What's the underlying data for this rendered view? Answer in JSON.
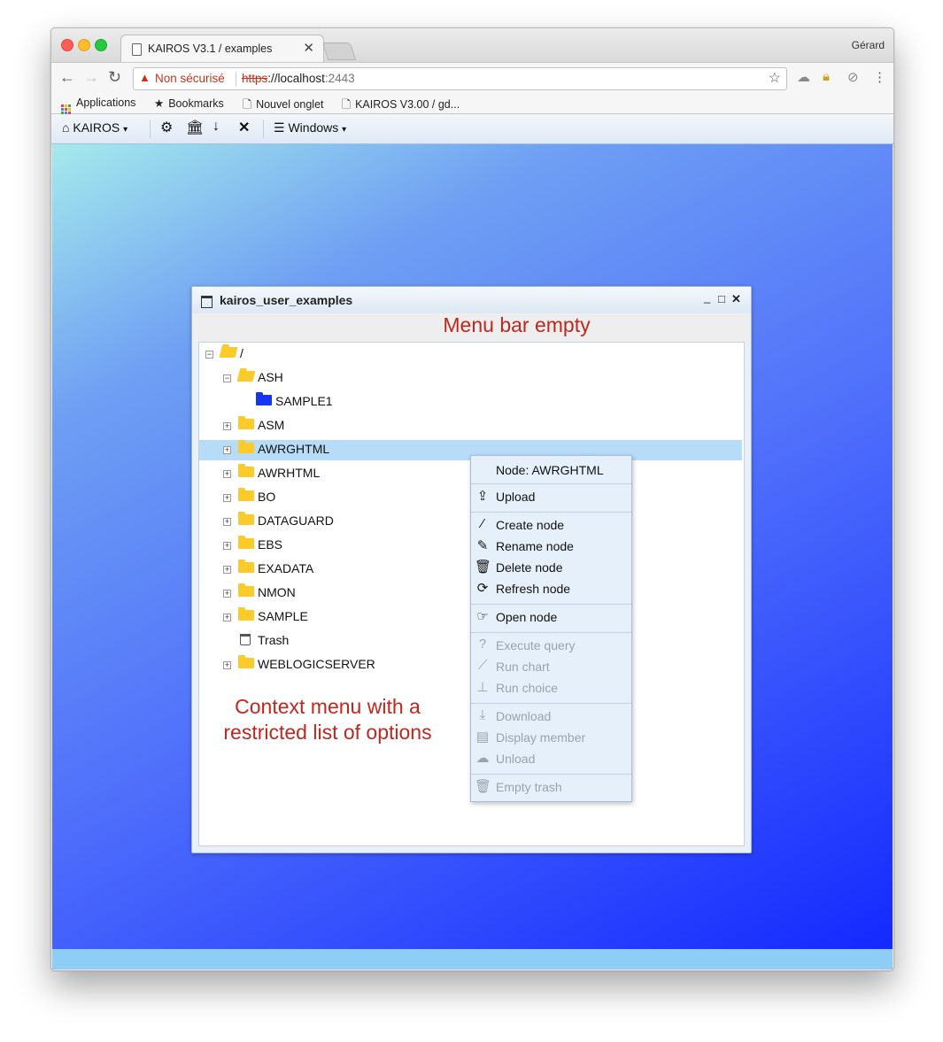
{
  "browser": {
    "tab_title": "KAIROS V3.1 / examples",
    "tab_close": "✕",
    "user": "Gérard",
    "security_label": "Non sécurisé",
    "url_scheme": "https",
    "url_sep": "://",
    "url_host": "localhost",
    "url_port": ":2443",
    "bookmarks": [
      {
        "label": "Applications",
        "icon": "apps-grid-icon"
      },
      {
        "label": "Bookmarks",
        "icon": "star-icon"
      },
      {
        "label": "Nouvel onglet",
        "icon": "document-icon"
      },
      {
        "label": "KAIROS V3.00 / gd...",
        "icon": "document-icon"
      }
    ]
  },
  "appbar": {
    "brand": "KAIROS",
    "windows_label": "Windows"
  },
  "window": {
    "title": "kairos_user_examples",
    "btn_min": "_",
    "btn_max": "□",
    "btn_close": "✕"
  },
  "annotations": {
    "menu_bar_note": "Menu bar empty",
    "context_note_line1": "Context menu with a",
    "context_note_line2": "restricted list of options"
  },
  "tree": {
    "root": "/",
    "nodes": [
      {
        "label": "ASH",
        "expanded": true
      },
      {
        "label": "SAMPLE1"
      },
      {
        "label": "ASM"
      },
      {
        "label": "AWRGHTML",
        "selected": true
      },
      {
        "label": "AWRHTML"
      },
      {
        "label": "BO"
      },
      {
        "label": "DATAGUARD"
      },
      {
        "label": "EBS"
      },
      {
        "label": "EXADATA"
      },
      {
        "label": "NMON"
      },
      {
        "label": "SAMPLE"
      },
      {
        "label": "Trash"
      },
      {
        "label": "WEBLOGICSERVER"
      }
    ]
  },
  "context_menu": {
    "header": "Node: AWRGHTML",
    "items": [
      {
        "label": "Upload",
        "icon": "upload-icon",
        "enabled": true
      },
      {
        "label": "Create node",
        "icon": "magic-wand-icon",
        "enabled": true
      },
      {
        "label": "Rename node",
        "icon": "pencil-icon",
        "enabled": true
      },
      {
        "label": "Delete node",
        "icon": "trash-icon",
        "enabled": true
      },
      {
        "label": "Refresh node",
        "icon": "refresh-icon",
        "enabled": true
      },
      {
        "label": "Open node",
        "icon": "hand-pointer-icon",
        "enabled": true
      },
      {
        "label": "Execute query",
        "icon": "question-icon",
        "enabled": false
      },
      {
        "label": "Run chart",
        "icon": "line-chart-icon",
        "enabled": false
      },
      {
        "label": "Run choice",
        "icon": "sitemap-icon",
        "enabled": false
      },
      {
        "label": "Download",
        "icon": "download-icon",
        "enabled": false
      },
      {
        "label": "Display member",
        "icon": "file-text-icon",
        "enabled": false
      },
      {
        "label": "Unload",
        "icon": "cloud-upload-icon",
        "enabled": false
      },
      {
        "label": "Empty trash",
        "icon": "trash-outline-icon",
        "enabled": false
      }
    ]
  },
  "colors": {
    "annotation_red": "#c0271e",
    "folder_yellow": "#fccb2a",
    "folder_blue": "#1436f0",
    "selection": "#b7dcf8",
    "statusbar": "#8ecdf6"
  }
}
